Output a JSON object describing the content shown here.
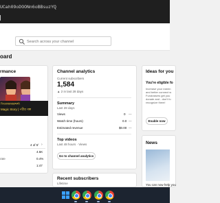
{
  "browser": {
    "url_partial": "UCah09oDOONn6oBBsuzYQ"
  },
  "header": {
    "search_placeholder": "Search across your channel"
  },
  "page": {
    "title_partial": "oard"
  },
  "performance_card": {
    "title_partial": "rmance",
    "video_title_line1": "পিতাজামারব্দর্শ্য",
    "video_title_line2": "Magic Story | পরীর গল্প",
    "rank_text": "4 of 5",
    "stats": [
      {
        "label": "",
        "value": "4.5K"
      },
      {
        "label": "",
        "value": "0.4%"
      },
      {
        "label": "rate",
        "value": "1:47"
      }
    ]
  },
  "analytics_card": {
    "title": "Channel analytics",
    "subscribers_label": "Current subscribers",
    "subscribers_value": "1,584",
    "subscribers_delta": "▲ 2 in last 28 days",
    "summary_title": "Summary",
    "summary_period": "Last 28 days",
    "summary_rows": [
      {
        "label": "Views",
        "value": "0",
        "trend": "—"
      },
      {
        "label": "Watch time (hours)",
        "value": "0.0",
        "trend": "—"
      },
      {
        "label": "Estimated revenue",
        "value": "$0.00",
        "trend": "—"
      }
    ],
    "top_videos_title": "Top videos",
    "top_videos_period": "Last 48 hours · Views",
    "go_button": "Go to channel analytics"
  },
  "subscribers_card": {
    "title": "Recent subscribers",
    "period": "Lifetime"
  },
  "ideas_card": {
    "title_partial": "Ideas for you",
    "heading_partial": "You're eligible fo",
    "body_lines": [
      "Increase your earnin",
      "and better connect w",
      "Fundraisers get you",
      "donate and - don't fo",
      "recognize them!"
    ],
    "enable_button": "Enable now"
  },
  "news_card": {
    "title": "News",
    "footer_partial": "You can now help you"
  },
  "colors": {
    "browser_bar": "#1f1f1f",
    "page_bg": "#f1f1f1",
    "card_bg": "#ffffff",
    "taskbar": "#1c2430",
    "accent_blue": "#065fd4"
  },
  "taskbar": {
    "icons": [
      "windows-icon",
      "chrome-icon",
      "chrome-icon",
      "chrome-icon",
      "chrome-icon"
    ]
  }
}
